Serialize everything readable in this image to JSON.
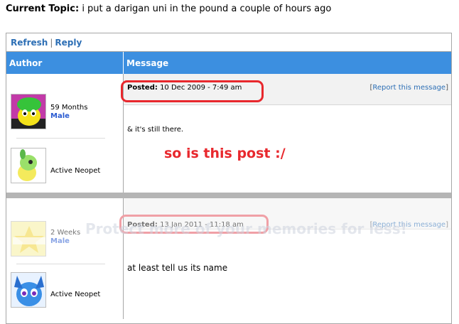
{
  "topic": {
    "label": "Current Topic:",
    "title": "i put a darigan uni in the pound a couple of hours ago"
  },
  "toolbar": {
    "refresh": "Refresh",
    "separator": "|",
    "reply": "Reply"
  },
  "header": {
    "author": "Author",
    "message": "Message"
  },
  "posts": [
    {
      "avatar_icon": "yellow-green-neopet-avatar-icon",
      "age": "59 Months",
      "gender": "Male",
      "sig_avatar_icon": "green-neopet-avatar-icon",
      "status": "Active Neopet",
      "posted_label": "Posted:",
      "posted_value": "10 Dec 2009 - 7:49 am",
      "report_open": "[",
      "report_label": "Report this message",
      "report_close": "]",
      "body": "& it's still there."
    },
    {
      "avatar_icon": "neopets-logo-avatar-icon",
      "age": "2 Weeks",
      "gender": "Male",
      "sig_avatar_icon": "blue-neopet-avatar-icon",
      "status": "Active Neopet",
      "posted_label": "Posted:",
      "posted_value": "13 Jan 2011 - 11:18 am",
      "report_open": "[",
      "report_label": "Report this message",
      "report_close": "]",
      "body": "at least tell us its name"
    }
  ],
  "annotation": "so is this post :/",
  "watermark": "Protect more of your memories for less!",
  "colors": {
    "header_bg": "#3c8fe0",
    "link": "#2d6fb5",
    "highlight": "#e8282d",
    "gender": "#2a5bd1"
  }
}
